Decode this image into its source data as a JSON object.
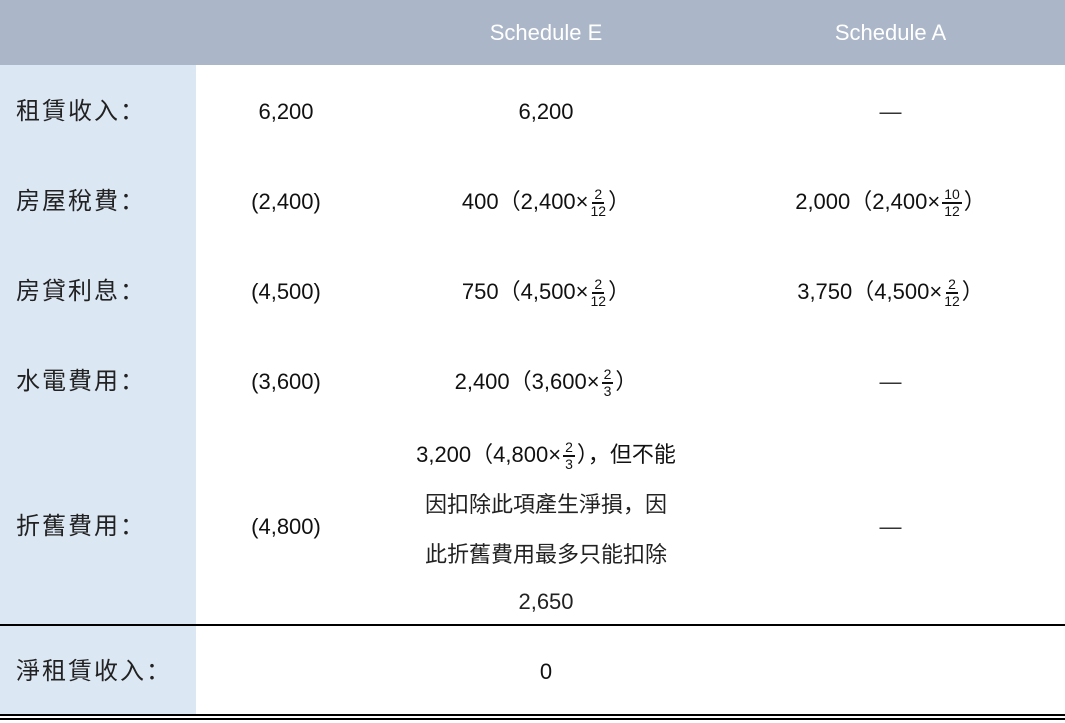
{
  "header": {
    "col0": "",
    "col1": "",
    "col2": "Schedule E",
    "col3": "Schedule A"
  },
  "colors": {
    "header_bg": "#abb7c8",
    "label_col_bg": "#dce7f4"
  },
  "rows": [
    {
      "label": "租賃收入：",
      "amount": "6,200",
      "schedule_e": {
        "value": "6,200"
      },
      "schedule_a": {
        "value": "—"
      }
    },
    {
      "label": "房屋稅費：",
      "amount": "(2,400)",
      "schedule_e": {
        "value": "400",
        "open": "（",
        "base": "2,400×",
        "num": "2",
        "den": "12",
        "close": "）"
      },
      "schedule_a": {
        "value": "2,000",
        "open": "（",
        "base": "2,400×",
        "num": "10",
        "den": "12",
        "close": "）"
      }
    },
    {
      "label": "房貸利息：",
      "amount": "(4,500)",
      "schedule_e": {
        "value": "750",
        "open": "（",
        "base": "4,500×",
        "num": "2",
        "den": "12",
        "close": "）"
      },
      "schedule_a": {
        "value": "3,750",
        "open": "（",
        "base": "4,500×",
        "num": "2",
        "den": "12",
        "close": "）"
      }
    },
    {
      "label": "水電費用：",
      "amount": "(3,600)",
      "schedule_e": {
        "value": "2,400",
        "open": "（",
        "base": "3,600×",
        "num": "2",
        "den": "3",
        "close": "）"
      },
      "schedule_a": {
        "value": "—"
      }
    },
    {
      "label": "折舊費用：",
      "amount": "(4,800)",
      "schedule_e": {
        "value": "3,200",
        "open": "（",
        "base": "4,800×",
        "num": "2",
        "den": "3",
        "close": "），但不能",
        "note_line2": "因扣除此項產生淨損，因",
        "note_line3": "此折舊費用最多只能扣除",
        "note_line4": "2,650"
      },
      "schedule_a": {
        "value": "—"
      }
    }
  ],
  "total": {
    "label": "淨租賃收入：",
    "schedule_e": "0"
  }
}
